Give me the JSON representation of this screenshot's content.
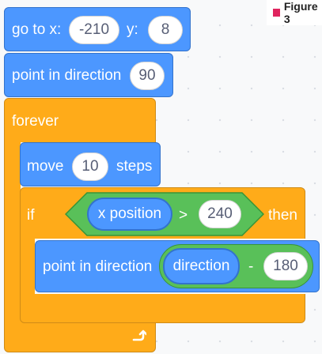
{
  "figure_label": "Figure 3",
  "blocks": {
    "goto": {
      "label": "go to x:",
      "x_value": "-210",
      "y_label": "y:",
      "y_value": "8"
    },
    "point1": {
      "label": "point in direction",
      "value": "90"
    },
    "forever": {
      "label": "forever",
      "loop_icon": "loop-arrow-icon"
    },
    "move": {
      "label_before": "move",
      "value": "10",
      "label_after": "steps"
    },
    "if_block": {
      "if_label": "if",
      "then_label": "then",
      "reporter": "x position",
      "operator": ">",
      "compare_value": "240"
    },
    "point2": {
      "label": "point in direction",
      "reporter": "direction",
      "operator": "-",
      "value": "180"
    }
  },
  "colors": {
    "motion": "#4c97ff",
    "control": "#ffab19",
    "operators": "#59c059"
  }
}
